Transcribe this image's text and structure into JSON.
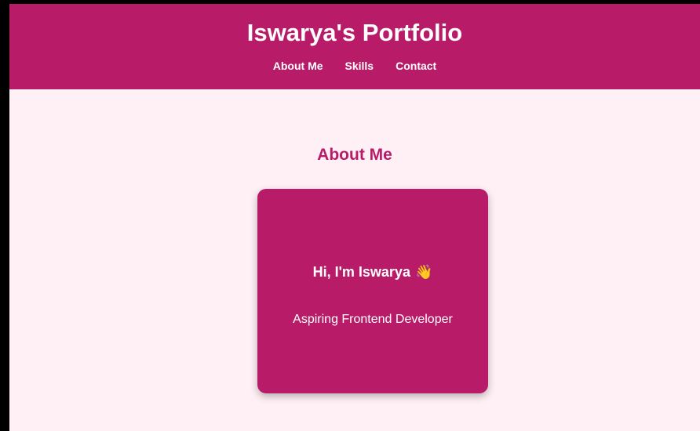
{
  "header": {
    "title": "Iswarya's Portfolio",
    "nav": [
      {
        "label": "About Me"
      },
      {
        "label": "Skills"
      },
      {
        "label": "Contact"
      }
    ]
  },
  "about": {
    "heading": "About Me",
    "card": {
      "greeting": "Hi, I'm Iswarya",
      "wave_emoji": "👋",
      "role": "Aspiring Frontend Developer"
    }
  },
  "colors": {
    "brand": "#b81c69",
    "background": "#fff0f5",
    "text_on_brand": "#ffffff"
  }
}
